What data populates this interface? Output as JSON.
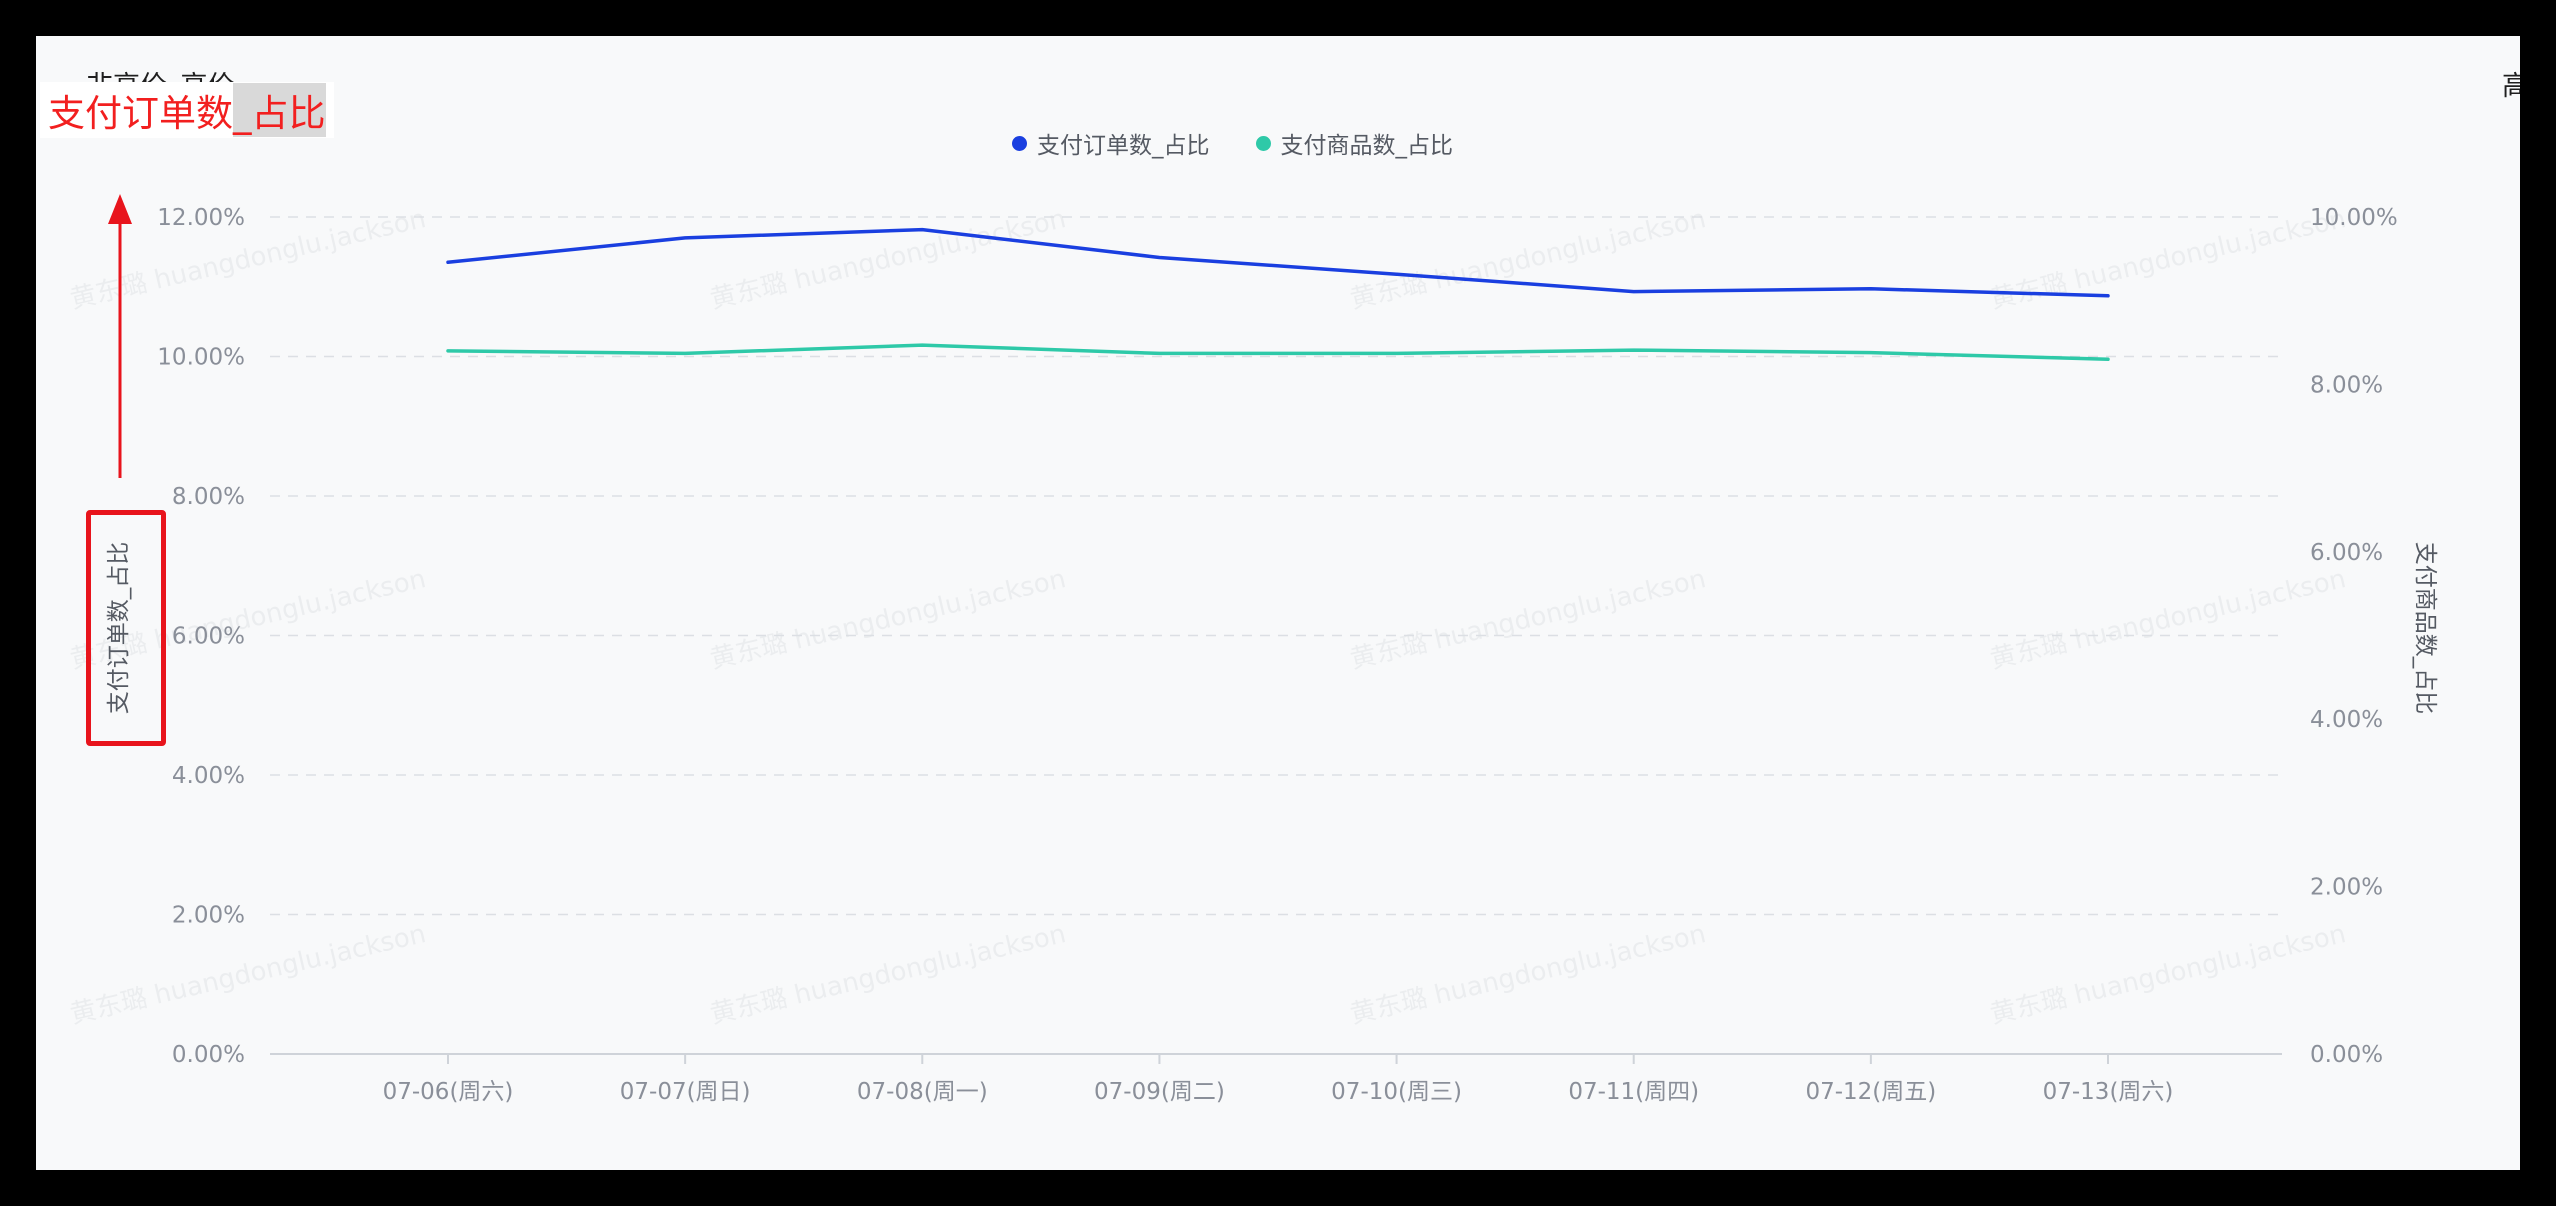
{
  "panel": {
    "title": "非高价_高价",
    "right_title_fragment": "高"
  },
  "annotation": {
    "callout_prefix": "支付订单数",
    "callout_highlight": "_占比",
    "arrow_color": "#e8141c",
    "box_color": "#e8141c"
  },
  "watermark": {
    "text": "黄东璐 huangdonglu.jackson"
  },
  "colors": {
    "series_order_share": "#1a3fe0",
    "series_goods_share": "#2ec9a8"
  },
  "chart_data": {
    "type": "line",
    "title": "",
    "categories": [
      "07-06(周六)",
      "07-07(周日)",
      "07-08(周一)",
      "07-09(周二)",
      "07-10(周三)",
      "07-11(周四)",
      "07-12(周五)",
      "07-13(周六)"
    ],
    "y_left": {
      "label": "支付订单数_占比",
      "ticks": [
        "0.00%",
        "2.00%",
        "4.00%",
        "6.00%",
        "8.00%",
        "10.00%",
        "12.00%"
      ],
      "ylim": [
        0,
        12
      ]
    },
    "y_right": {
      "label": "支付商品数_占比",
      "ticks": [
        "0.00%",
        "2.00%",
        "4.00%",
        "6.00%",
        "8.00%",
        "10.00%"
      ],
      "ylim": [
        0,
        10
      ]
    },
    "grid": true,
    "legend_position": "top-center",
    "series": [
      {
        "name": "支付订单数_占比",
        "axis": "left",
        "color": "#1a3fe0",
        "values": [
          11.35,
          11.7,
          11.82,
          11.42,
          11.18,
          10.93,
          10.97,
          10.87
        ]
      },
      {
        "name": "支付商品数_占比",
        "axis": "right",
        "color": "#2ec9a8",
        "values": [
          8.4,
          8.37,
          8.47,
          8.37,
          8.37,
          8.41,
          8.38,
          8.3
        ]
      }
    ]
  }
}
